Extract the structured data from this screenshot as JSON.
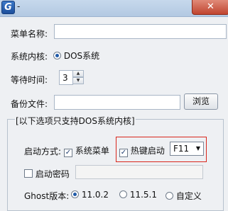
{
  "window": {
    "title": "-",
    "app_icon_letter": "G",
    "close_symbol": "✕"
  },
  "menu_name": {
    "label": "菜单名称:",
    "value": ""
  },
  "kernel": {
    "label": "系统内核:",
    "option": "DOS系统",
    "selected": true
  },
  "wait_time": {
    "label": "等待时间:",
    "value": "3",
    "up": "▲",
    "down": "▼"
  },
  "backup": {
    "label": "备份文件:",
    "value": "",
    "browse_label": "浏览"
  },
  "dos_group": {
    "title": "[以下选项只支持DOS系统内核]",
    "start_mode_label": "启动方式:",
    "system_menu": {
      "label": "系统菜单",
      "checked": true
    },
    "hotkey_boot": {
      "label": "热键启动",
      "checked": true
    },
    "hotkey_select": {
      "value": "F11",
      "arrow": "▼"
    },
    "boot_password": {
      "label": "启动密码",
      "checked": false,
      "value": ""
    },
    "ghost_version_label": "Ghost版本:",
    "ghost_versions": [
      {
        "label": "11.0.2",
        "selected": true
      },
      {
        "label": "11.5.1",
        "selected": false
      },
      {
        "label": "自定义",
        "selected": false
      }
    ]
  },
  "colors": {
    "highlight_border": "#d9261c",
    "accent": "#1f5aa8"
  }
}
